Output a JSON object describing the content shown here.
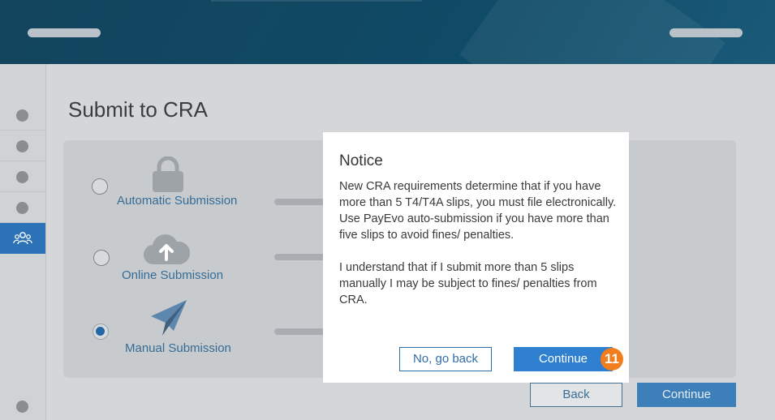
{
  "page": {
    "title": "Submit to CRA"
  },
  "sidebar": {
    "steps": [
      {
        "state": "done"
      },
      {
        "state": "done"
      },
      {
        "state": "done"
      },
      {
        "state": "done"
      },
      {
        "state": "active",
        "icon": "users-icon"
      }
    ]
  },
  "options": [
    {
      "label": "Automatic Submission",
      "icon": "lock-icon",
      "selected": false
    },
    {
      "label": "Online Submission",
      "icon": "cloud-upload-icon",
      "selected": false
    },
    {
      "label": "Manual Submission",
      "icon": "paper-plane-icon",
      "selected": true
    }
  ],
  "dialog": {
    "title": "Notice",
    "paragraph1": "New CRA requirements determine that if you have more than 5 T4/T4A slips, you must file electronically. Use PayEvo auto-submission if you have more than five slips to avoid fines/ penalties.",
    "paragraph2": "I understand that if I submit more than 5 slips manually I may be subject to fines/ penalties from CRA.",
    "cancel_label": "No, go back",
    "confirm_label": "Continue"
  },
  "step_badge": "11",
  "footer": {
    "back_label": "Back",
    "continue_label": "Continue"
  },
  "colors": {
    "header": "#13445d",
    "accent": "#2f80d0",
    "badge": "#f07e1e",
    "active_step": "#2b72b6"
  }
}
